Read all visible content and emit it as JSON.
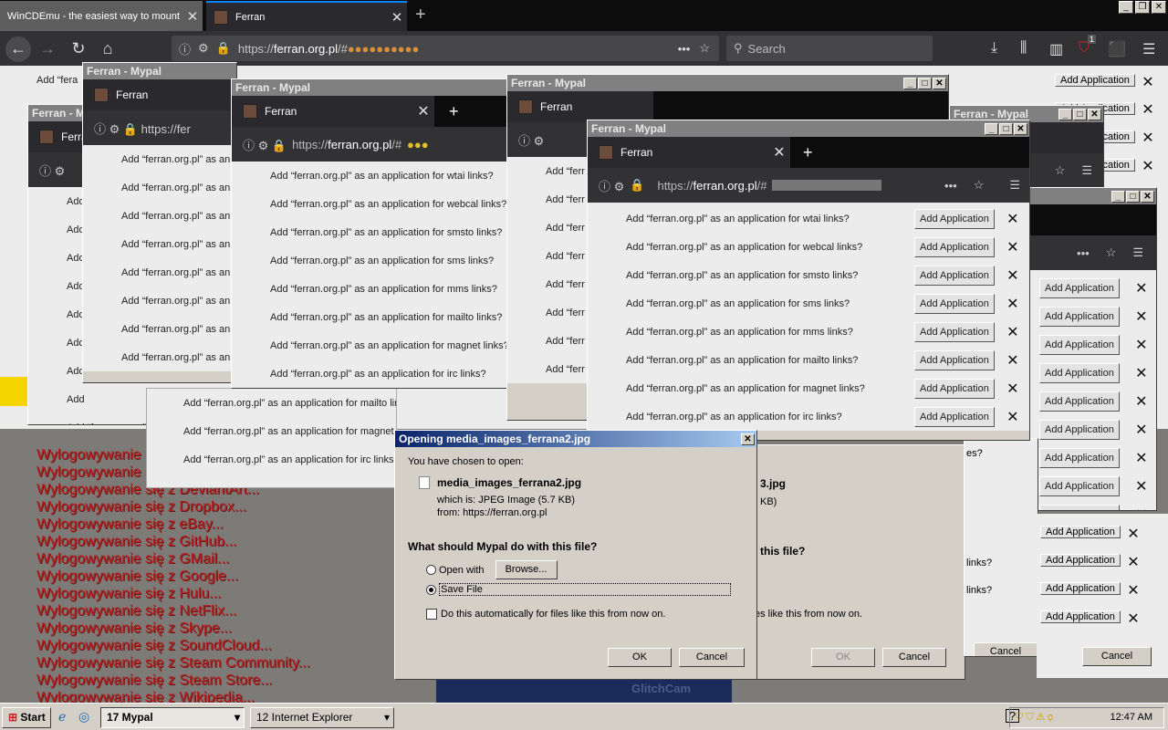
{
  "tabs": [
    {
      "title": "WinCDEmu - the easiest way to mount",
      "close": "✕"
    },
    {
      "title": "Ferran",
      "close": "✕"
    }
  ],
  "new_tab": "+",
  "url": {
    "prefix": "https://",
    "domain": "ferran.org.pl",
    "suffix": "/#"
  },
  "search": {
    "placeholder": "Search"
  },
  "ublock_badge": "1",
  "window_title": "Ferran - Mypal",
  "tab_title": "Ferran",
  "add_application_label": "Add Application",
  "handler_rows": [
    "Add “ferran.org.pl” as an application for wtai links?",
    "Add “ferran.org.pl” as an application for webcal links?",
    "Add “ferran.org.pl” as an application for smsto links?",
    "Add “ferran.org.pl” as an application for sms links?",
    "Add “ferran.org.pl” as an application for mms links?",
    "Add “ferran.org.pl” as an application for mailto links?",
    "Add “ferran.org.pl” as an application for magnet links?",
    "Add “ferran.org.pl” as an application for irc links?"
  ],
  "truncated_row": "Add “ferran.org.pl” as an",
  "short_row": "Add",
  "logout_links": [
    "Wylogowywanie się z DeviantArt...",
    "Wylogowywanie się z Dropbox...",
    "Wylogowywanie się z eBay...",
    "Wylogowywanie się z GitHub...",
    "Wylogowywanie się z GMail...",
    "Wylogowywanie się z Google...",
    "Wylogowywanie się z Hulu...",
    "Wylogowywanie się z NetFlix...",
    "Wylogowywanie się z Skype...",
    "Wylogowywanie się z SoundCloud...",
    "Wylogowywanie się z Steam Community...",
    "Wylogowywanie się z Steam Store...",
    "Wylogowywanie się z Wikipedia..."
  ],
  "dialog": {
    "title": "Opening media_images_ferrana2.jpg",
    "intro": "You have chosen to open:",
    "filename": "media_images_ferrana2.jpg",
    "which_is": "which is:  JPEG Image (5.7 KB)",
    "from": "from:  https://ferran.org.pl",
    "question": "What should Mypal do with this file?",
    "open_with": "Open with",
    "browse": "Browse...",
    "save_file": "Save File",
    "auto_text": "Do this automatically for files like this from now on.",
    "ok": "OK",
    "cancel": "Cancel"
  },
  "back_dialog": {
    "filename_tail": "3.jpg",
    "size_tail": "KB)",
    "question_tail": "this file?",
    "auto_tail": "es like this from now on.",
    "ok": "OK",
    "cancel": "Cancel"
  },
  "overflow_rows": [
    "es?",
    "links?",
    "links?"
  ],
  "watermark": "GlitchCam",
  "taskbar": {
    "start": "Start",
    "task1": "17 Mypal",
    "task2": "12 Internet Explorer",
    "clock": "12:47 AM"
  }
}
